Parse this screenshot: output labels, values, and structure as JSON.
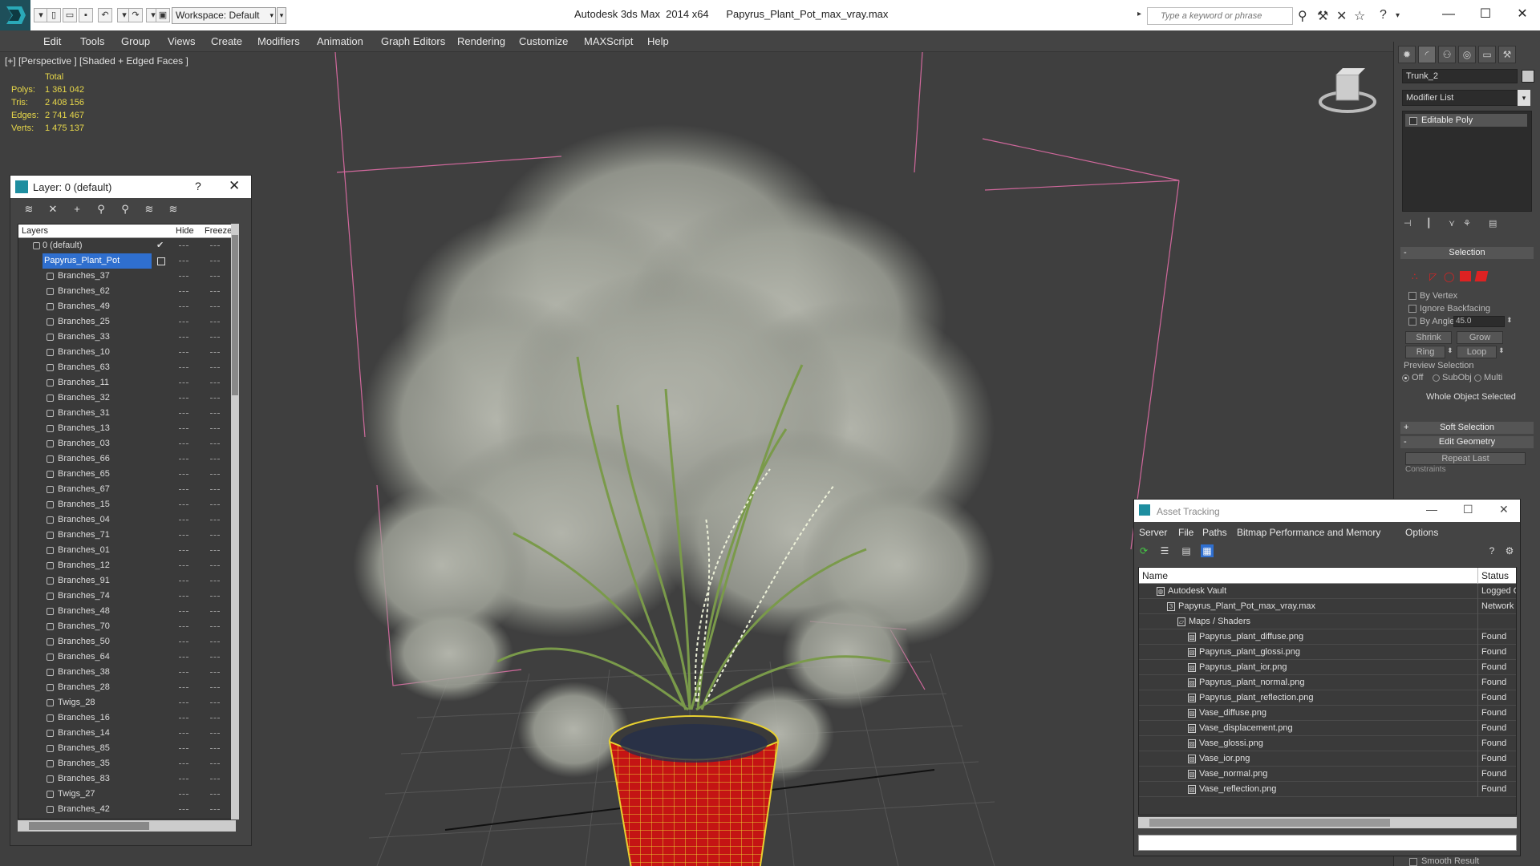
{
  "app": {
    "title": "Autodesk 3ds Max  2014 x64      Papyrus_Plant_Pot_max_vray.max",
    "workspace": "Workspace: Default",
    "search_placeholder": "Type a keyword or phrase"
  },
  "menu": [
    "Edit",
    "Tools",
    "Group",
    "Views",
    "Create",
    "Modifiers",
    "Animation",
    "Graph Editors",
    "Rendering",
    "Customize",
    "MAXScript",
    "Help"
  ],
  "viewport": {
    "label": "[+] [Perspective ] [Shaded + Edged Faces ]",
    "stats": {
      "header": "Total",
      "rows": [
        {
          "label": "Polys:",
          "value": "1 361 042"
        },
        {
          "label": "Tris:",
          "value": "2 408 156"
        },
        {
          "label": "Edges:",
          "value": "2 741 467"
        },
        {
          "label": "Verts:",
          "value": "1 475 137"
        }
      ]
    }
  },
  "layer_panel": {
    "title": "Layer: 0 (default)",
    "help": "?",
    "close": "✕",
    "columns": {
      "layers": "Layers",
      "hide": "Hide",
      "freeze": "Freeze"
    },
    "default_layer": "0 (default)",
    "selected_layer": "Papyrus_Plant_Pot",
    "objects": [
      "Branches_37",
      "Branches_62",
      "Branches_49",
      "Branches_25",
      "Branches_33",
      "Branches_10",
      "Branches_63",
      "Branches_11",
      "Branches_32",
      "Branches_31",
      "Branches_13",
      "Branches_03",
      "Branches_66",
      "Branches_65",
      "Branches_67",
      "Branches_15",
      "Branches_04",
      "Branches_71",
      "Branches_01",
      "Branches_12",
      "Branches_91",
      "Branches_74",
      "Branches_48",
      "Branches_70",
      "Branches_50",
      "Branches_64",
      "Branches_38",
      "Branches_28",
      "Twigs_28",
      "Branches_16",
      "Branches_14",
      "Branches_85",
      "Branches_35",
      "Branches_83",
      "Twigs_27",
      "Branches_42"
    ]
  },
  "command_panel": {
    "object_name": "Trunk_2",
    "modifier_list": "Modifier List",
    "stack_item": "Editable Poly",
    "selection": {
      "title": "Selection",
      "by_vertex": "By Vertex",
      "ignore_backfacing": "Ignore Backfacing",
      "by_angle": "By Angle:",
      "angle_value": "45.0",
      "shrink": "Shrink",
      "grow": "Grow",
      "ring": "Ring",
      "loop": "Loop",
      "preview_selection": "Preview Selection",
      "preview_off": "Off",
      "preview_subobj": "SubObj",
      "preview_multi": "Multi",
      "status": "Whole Object Selected"
    },
    "soft_selection": "Soft Selection",
    "edit_geometry": "Edit Geometry",
    "repeat_last": "Repeat Last",
    "constraints": "Constraints",
    "smooth_result": "Smooth Result"
  },
  "asset_tracking": {
    "title": "Asset Tracking",
    "menu": [
      "Server",
      "File",
      "Paths",
      "Bitmap Performance and Memory",
      "Options"
    ],
    "columns": {
      "name": "Name",
      "status": "Status"
    },
    "rows": [
      {
        "name": "Autodesk Vault",
        "status": "Logged O",
        "level": 0,
        "icon": "vault-icon"
      },
      {
        "name": "Papyrus_Plant_Pot_max_vray.max",
        "status": "Network",
        "level": 1,
        "icon": "max-file-icon"
      },
      {
        "name": "Maps / Shaders",
        "status": "",
        "level": 2,
        "icon": "maps-folder-icon"
      },
      {
        "name": "Papyrus_plant_diffuse.png",
        "status": "Found",
        "level": 3,
        "icon": "bitmap-file-icon"
      },
      {
        "name": "Papyrus_plant_glossi.png",
        "status": "Found",
        "level": 3,
        "icon": "bitmap-file-icon"
      },
      {
        "name": "Papyrus_plant_ior.png",
        "status": "Found",
        "level": 3,
        "icon": "bitmap-file-icon"
      },
      {
        "name": "Papyrus_plant_normal.png",
        "status": "Found",
        "level": 3,
        "icon": "bitmap-file-icon"
      },
      {
        "name": "Papyrus_plant_reflection.png",
        "status": "Found",
        "level": 3,
        "icon": "bitmap-file-icon"
      },
      {
        "name": "Vase_diffuse.png",
        "status": "Found",
        "level": 3,
        "icon": "bitmap-file-icon"
      },
      {
        "name": "Vase_displacement.png",
        "status": "Found",
        "level": 3,
        "icon": "bitmap-file-icon"
      },
      {
        "name": "Vase_glossi.png",
        "status": "Found",
        "level": 3,
        "icon": "bitmap-file-icon"
      },
      {
        "name": "Vase_ior.png",
        "status": "Found",
        "level": 3,
        "icon": "bitmap-file-icon"
      },
      {
        "name": "Vase_normal.png",
        "status": "Found",
        "level": 3,
        "icon": "bitmap-file-icon"
      },
      {
        "name": "Vase_reflection.png",
        "status": "Found",
        "level": 3,
        "icon": "bitmap-file-icon"
      }
    ]
  },
  "colors": {
    "selection_blue": "#2f6fcf",
    "stats_yellow": "#e8d84a",
    "bbox_pink": "#d0689c",
    "pot_red": "#c01010",
    "wire_yellow": "#e8d030"
  }
}
